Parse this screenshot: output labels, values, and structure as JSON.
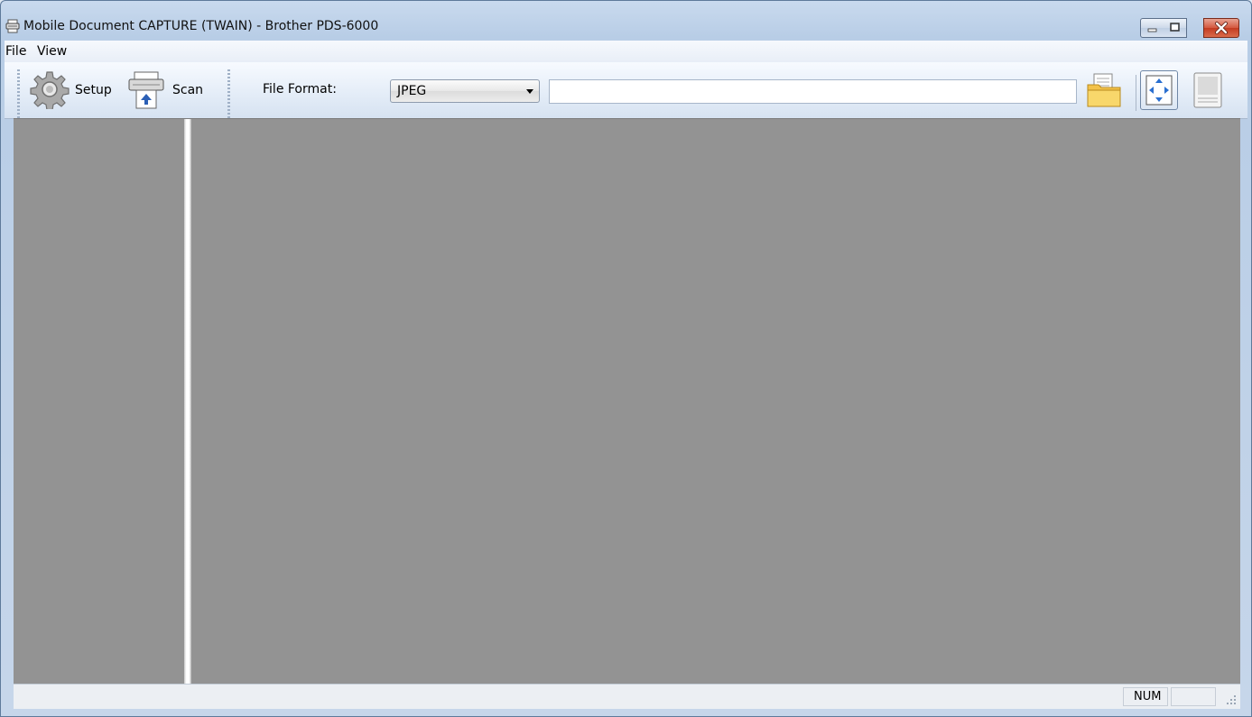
{
  "window": {
    "title": "Mobile Document CAPTURE (TWAIN) - Brother PDS-6000",
    "icon": "scanner-icon",
    "controls": [
      "minimize-icon",
      "restore-icon",
      "close-icon"
    ]
  },
  "menubar": {
    "items": [
      {
        "label": "File"
      },
      {
        "label": "View"
      }
    ]
  },
  "toolbar": {
    "setup_label": "Setup",
    "setup_icon": "gear-icon",
    "scan_label": "Scan",
    "scan_icon": "scanner-icon",
    "file_format_label": "File Format:",
    "file_format_value": "JPEG",
    "file_path_value": "",
    "browse_icon": "folder-icon",
    "fit_to_window_icon": "fit-to-window-icon",
    "page_view_icon": "page-icon"
  },
  "statusbar": {
    "message": "",
    "num_indicator": "NUM",
    "extra": ""
  },
  "colors": {
    "canvas": "#939393",
    "chrome": "#c6d6ea",
    "close_button": "#d4573e"
  }
}
